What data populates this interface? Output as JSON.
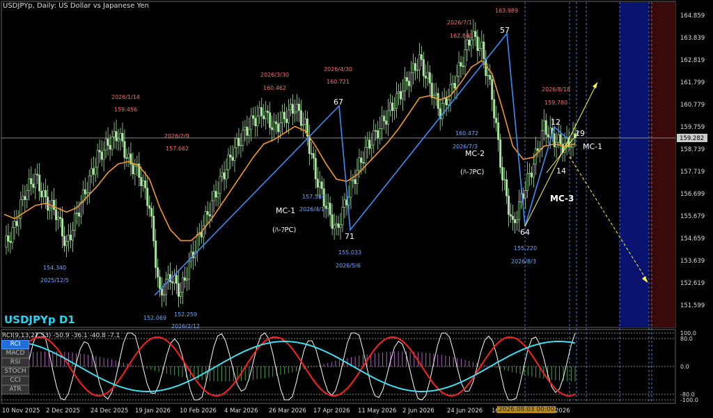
{
  "window": {
    "caption": "USDJPYp, Daily:  US Dollar vs Japanese Yen",
    "symbol_label": "USDJPYp D1",
    "current_price": "159.282"
  },
  "price_axis": [
    "164.859",
    "163.839",
    "162.819",
    "161.799",
    "160.779",
    "159.759",
    "158.739",
    "157.719",
    "156.699",
    "155.679",
    "154.659",
    "153.639",
    "152.619",
    "151.599"
  ],
  "time_axis": [
    "10 Nov 2025",
    "2 Dec 2025",
    "24 Dec 2025",
    "19 Jan 2026",
    "10 Feb 2026",
    "4 Mar 2026",
    "26 Mar 2026",
    "17 Apr 2026",
    "11 May 2026",
    "2 Jun 2026",
    "24 Jun 2026",
    "16",
    "2026.08.03 00:00",
    "2026"
  ],
  "cursor_date": "2026.08.03 00:00",
  "annotations": {
    "highs": [
      {
        "date": "2026/1/14",
        "price": "159.456"
      },
      {
        "date": "2026/3/30",
        "price": "160.462"
      },
      {
        "date": "2026/4/30",
        "price": "160.721"
      },
      {
        "date": "2026/7/1",
        "price": "162.841"
      },
      {
        "date": "2026/2/9",
        "price": "157.662"
      },
      {
        "date": "2026/8/18",
        "price": "159.780"
      },
      {
        "date": "",
        "price": "163.989"
      }
    ],
    "lows": [
      {
        "date": "2025/12/5",
        "price": "154.340"
      },
      {
        "date": "2026/2/12",
        "price": "152.069"
      },
      {
        "date": "",
        "price": "152.259"
      },
      {
        "date": "2026/4/17",
        "price": "157.584"
      },
      {
        "date": "2026/5/6",
        "price": "155.033"
      },
      {
        "date": "2026/7/3",
        "price": "160.472"
      },
      {
        "date": "2026/8/3",
        "price": "155.220"
      }
    ],
    "wave_counts": [
      "67",
      "71",
      "57",
      "64",
      "12",
      "19",
      "14"
    ],
    "mc_labels": [
      "MC-1",
      "MC-2",
      "MC-3",
      "MC-1"
    ],
    "pc_label": "(ﾊ-ﾌPC)"
  },
  "oscillator": {
    "caption": "RCI(9,13,27,53) -50.9 -36.1 -40.8 -7.1",
    "levels": [
      "100.0",
      "80.0",
      "0.0",
      "-80.0",
      "-100.0"
    ],
    "buttons": [
      "RCI",
      "MACD",
      "RSI",
      "STOCH",
      "CCI",
      "ATR"
    ],
    "active_button": "RCI"
  },
  "colors": {
    "background": "#000000",
    "bull_candle": "#a8e6a0",
    "ma": "#f59a2a",
    "wave": "#3d8ef5",
    "projection": "#ffff44",
    "zone_blue": "#0a1470",
    "zone_red": "#3a0a0a",
    "label_red": "#f07070",
    "label_blue": "#6ea8ff"
  },
  "chart_data": {
    "type": "line",
    "title": "USDJPYp, Daily:  US Dollar vs Japanese Yen",
    "xlabel": "",
    "ylabel": "",
    "ylim": [
      151.1,
      165.3
    ],
    "series": [
      {
        "values": [
          154.3,
          155.2,
          156.8,
          157.5,
          156.4,
          155.9,
          154.34,
          155.8,
          157.1,
          158.4,
          159.0,
          159.456,
          158.2,
          157.662,
          156.2,
          152.069,
          153.0,
          152.259,
          153.8,
          155.1,
          156.3,
          157.5,
          158.6,
          159.4,
          160.1,
          160.462,
          159.7,
          160.2,
          160.721,
          159.8,
          157.584,
          156.2,
          155.033,
          156.5,
          157.8,
          158.9,
          159.6,
          160.4,
          161.2,
          162.0,
          162.841,
          161.7,
          160.472,
          161.4,
          162.6,
          163.989,
          163.3,
          161.2,
          157.5,
          155.22,
          156.8,
          158.1,
          159.78,
          159.2,
          158.9,
          159.282
        ]
      }
    ],
    "ma_values": [
      155.8,
      155.6,
      155.9,
      156.2,
      156.3,
      156.1,
      155.9,
      156.1,
      156.6,
      157.1,
      157.7,
      158.1,
      158.2,
      158.0,
      157.4,
      156.1,
      155.1,
      154.6,
      154.6,
      155.0,
      155.6,
      156.3,
      157.0,
      157.7,
      158.4,
      159.0,
      159.2,
      159.5,
      159.8,
      159.6,
      158.9,
      158.1,
      157.4,
      157.3,
      157.6,
      158.1,
      158.6,
      159.1,
      159.7,
      160.4,
      161.1,
      161.2,
      161.0,
      161.2,
      161.8,
      162.5,
      162.8,
      162.2,
      160.6,
      158.9,
      158.3,
      158.4,
      158.9,
      159.0,
      158.9,
      159.0
    ]
  }
}
